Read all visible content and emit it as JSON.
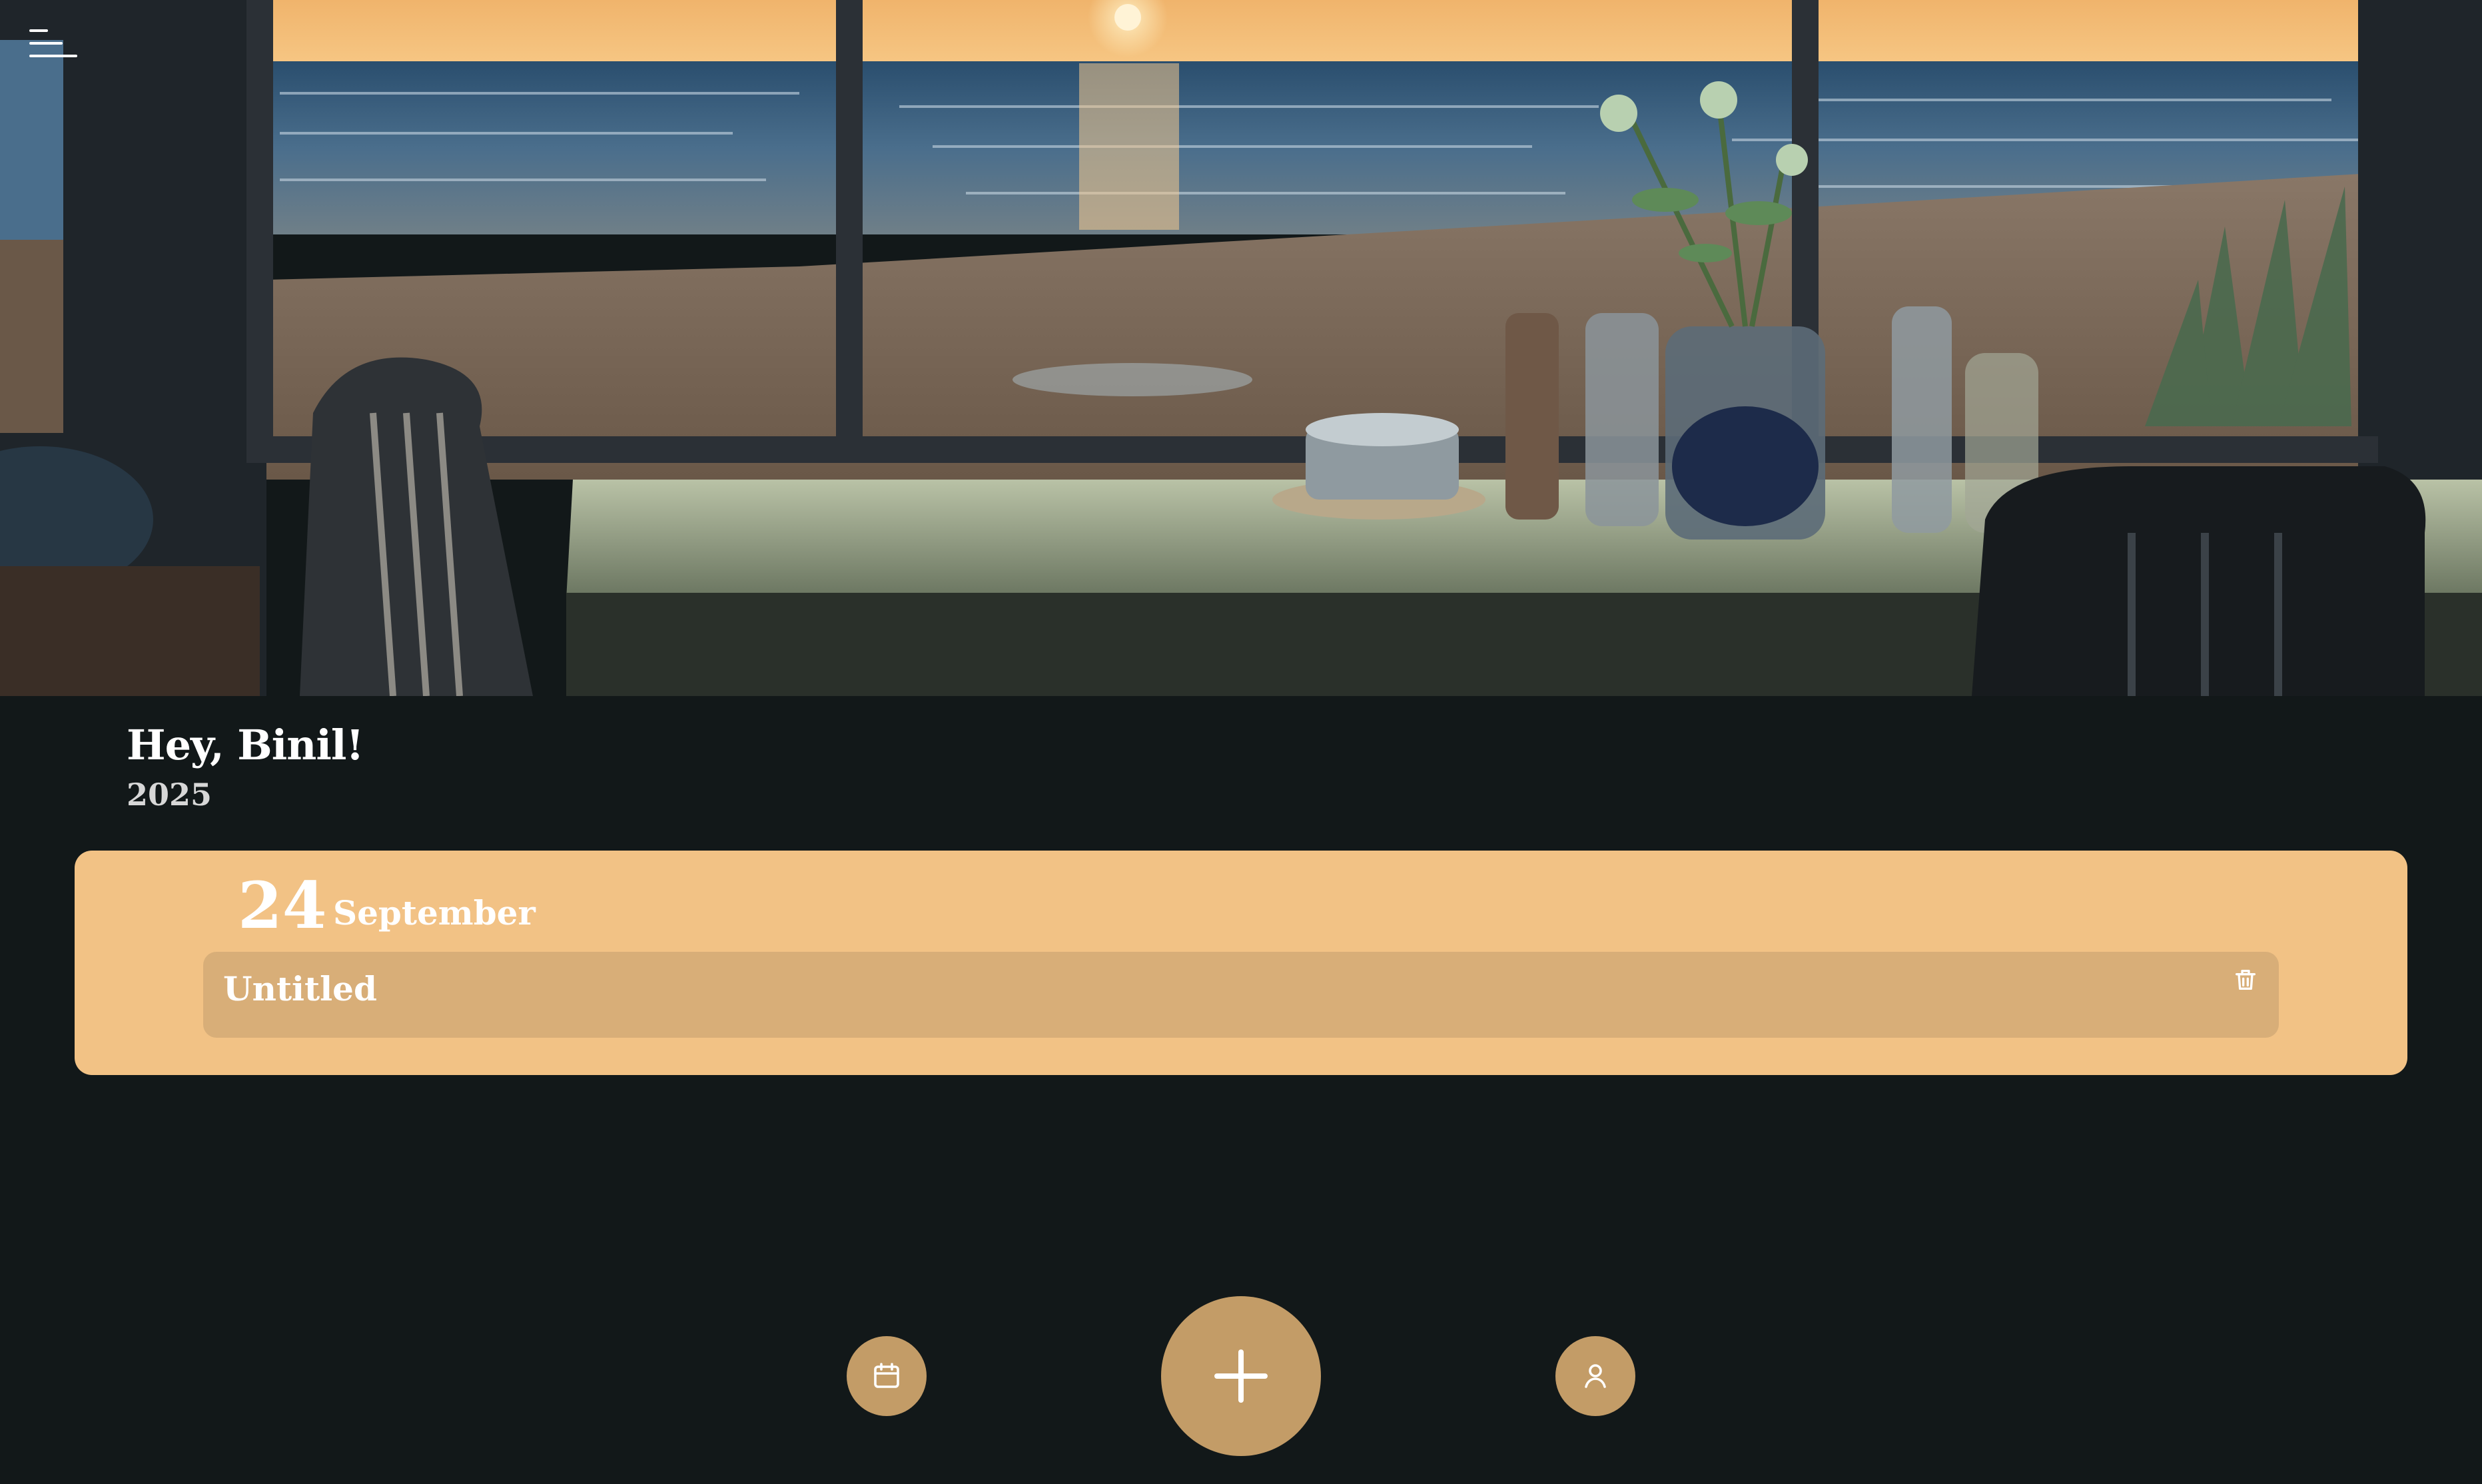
{
  "header": {
    "greeting": "Hey, Binil!",
    "year": "2025"
  },
  "entries_by_day": [
    {
      "day": "24",
      "month": "September",
      "entries": [
        {
          "title": "Untitled"
        }
      ]
    }
  ],
  "nav": {
    "left_icon": "calendar-icon",
    "center_icon": "plus-icon",
    "right_icon": "user-icon"
  },
  "colors": {
    "background": "#121819",
    "card": "#f2c285",
    "entry": "#d8ae78",
    "nav_button": "#c39c67"
  }
}
